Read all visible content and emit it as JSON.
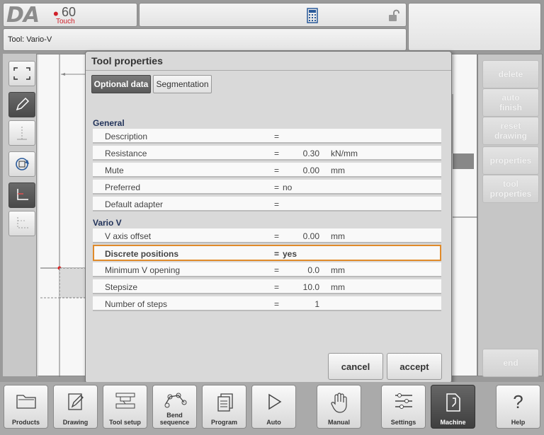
{
  "header": {
    "logo_text": "DA",
    "logo_number": "60",
    "logo_sub": "Touch",
    "tool_label": "Tool: Vario-V"
  },
  "right_panel": {
    "buttons": [
      {
        "label": "delete"
      },
      {
        "label": "auto\nfinish"
      },
      {
        "label": "reset\ndrawing"
      },
      {
        "label": "properties"
      },
      {
        "label": "tool\nproperties"
      },
      {
        "label": "end"
      }
    ]
  },
  "dialog": {
    "title": "Tool properties",
    "tabs": [
      {
        "label": "Optional data",
        "active": true
      },
      {
        "label": "Segmentation",
        "active": false
      }
    ],
    "sections": [
      {
        "title": "General",
        "rows": [
          {
            "label": "Description",
            "eq": "=",
            "value": "",
            "unit": ""
          },
          {
            "label": "Resistance",
            "eq": "=",
            "value": "0.30",
            "unit": "kN/mm"
          },
          {
            "label": "Mute",
            "eq": "=",
            "value": "0.00",
            "unit": "mm"
          },
          {
            "label": "Preferred",
            "eq": "=",
            "value": "no",
            "unit": ""
          },
          {
            "label": "Default adapter",
            "eq": "=",
            "value": "",
            "unit": ""
          }
        ]
      },
      {
        "title": "Vario V",
        "rows": [
          {
            "label": "V axis offset",
            "eq": "=",
            "value": "0.00",
            "unit": "mm"
          },
          {
            "label": "Discrete positions",
            "eq": "=",
            "value": "yes",
            "unit": ""
          },
          {
            "label": "Minimum V opening",
            "eq": "=",
            "value": "0.0",
            "unit": "mm"
          },
          {
            "label": "Stepsize",
            "eq": "=",
            "value": "10.0",
            "unit": "mm"
          },
          {
            "label": "Number of steps",
            "eq": "=",
            "value": "1",
            "unit": ""
          }
        ]
      }
    ],
    "cancel_label": "cancel",
    "accept_label": "accept"
  },
  "nav": [
    {
      "label": "Products"
    },
    {
      "label": "Drawing"
    },
    {
      "label": "Tool setup"
    },
    {
      "label": "Bend\nsequence"
    },
    {
      "label": "Program"
    },
    {
      "label": "Auto"
    },
    {
      "label": "Manual"
    },
    {
      "label": "Settings"
    },
    {
      "label": "Machine"
    },
    {
      "label": "Help"
    }
  ],
  "colors": {
    "selected_row_border": "#e08a2a",
    "logo_red": "#d0202a",
    "active_button": "#4a4a4a"
  }
}
